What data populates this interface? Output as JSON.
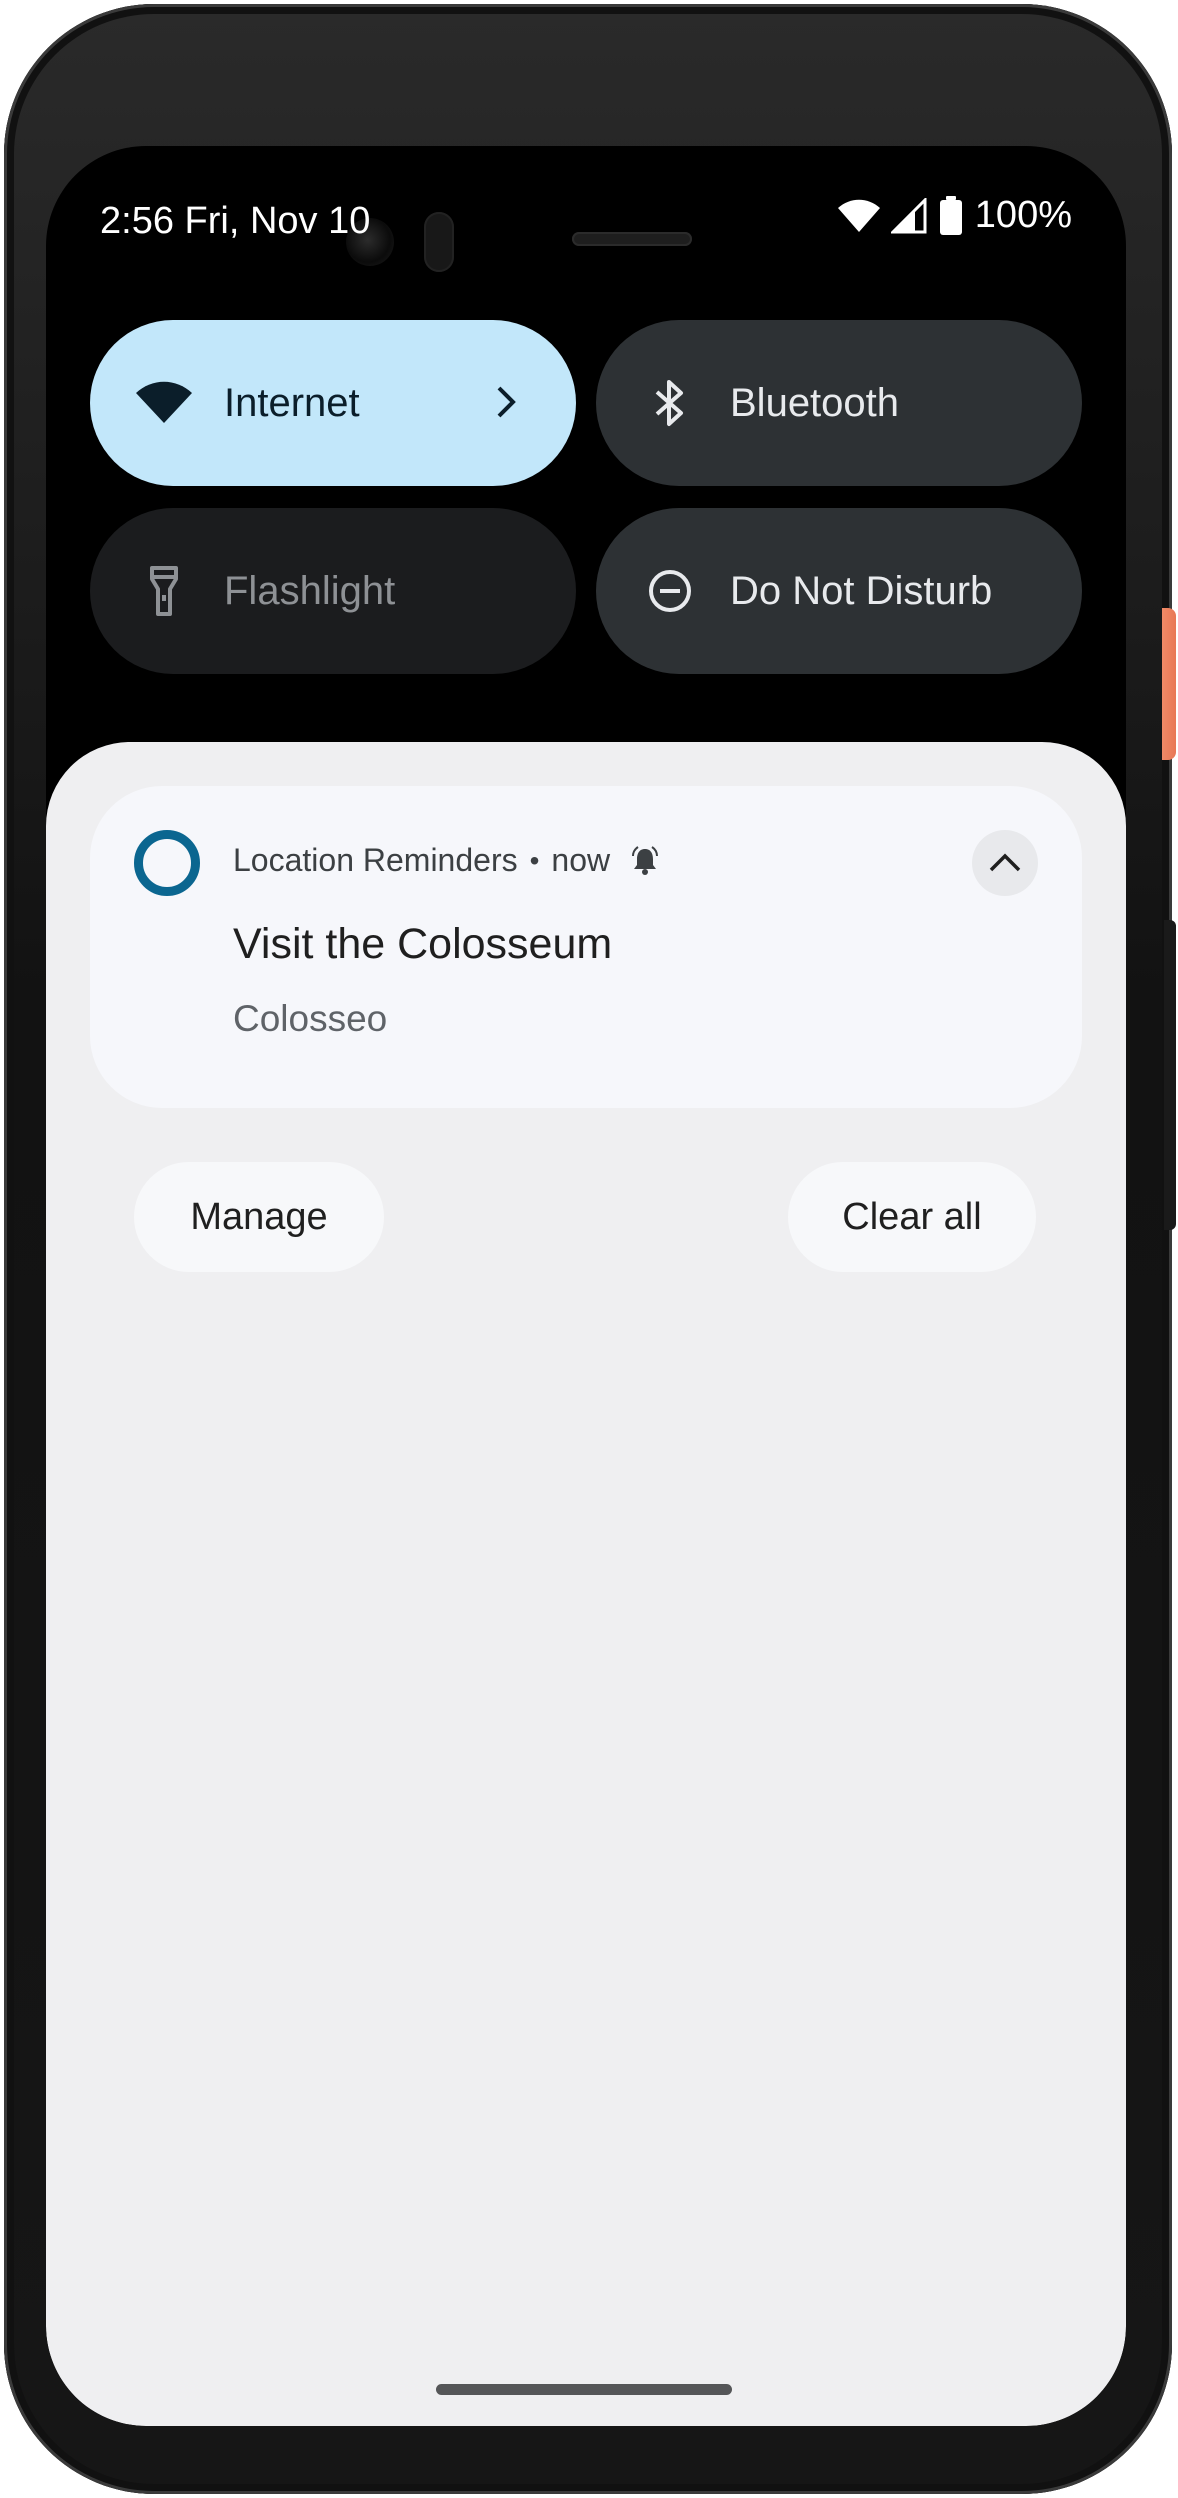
{
  "status_bar": {
    "time_date": "2:56 Fri, Nov 10",
    "battery_percent": "100%"
  },
  "quick_settings": {
    "tiles": [
      {
        "label": "Internet",
        "icon": "wifi-icon",
        "state": "on"
      },
      {
        "label": "Bluetooth",
        "icon": "bluetooth-icon",
        "state": "off"
      },
      {
        "label": "Flashlight",
        "icon": "flashlight-icon",
        "state": "unavailable"
      },
      {
        "label": "Do Not Disturb",
        "icon": "do-not-disturb-icon",
        "state": "off"
      }
    ]
  },
  "notification": {
    "app_name": "Location Reminders",
    "separator": "•",
    "time": "now",
    "title": "Visit the Colosseum",
    "text": "Colosseo",
    "app_icon_color": "#0b6690"
  },
  "actions": {
    "manage_label": "Manage",
    "clear_all_label": "Clear all"
  },
  "colors": {
    "internet_tile": "#c2e7fa",
    "dark_tile": "#2d3134",
    "shade_background": "#efeff1",
    "accent_power_button": "#e87755"
  }
}
